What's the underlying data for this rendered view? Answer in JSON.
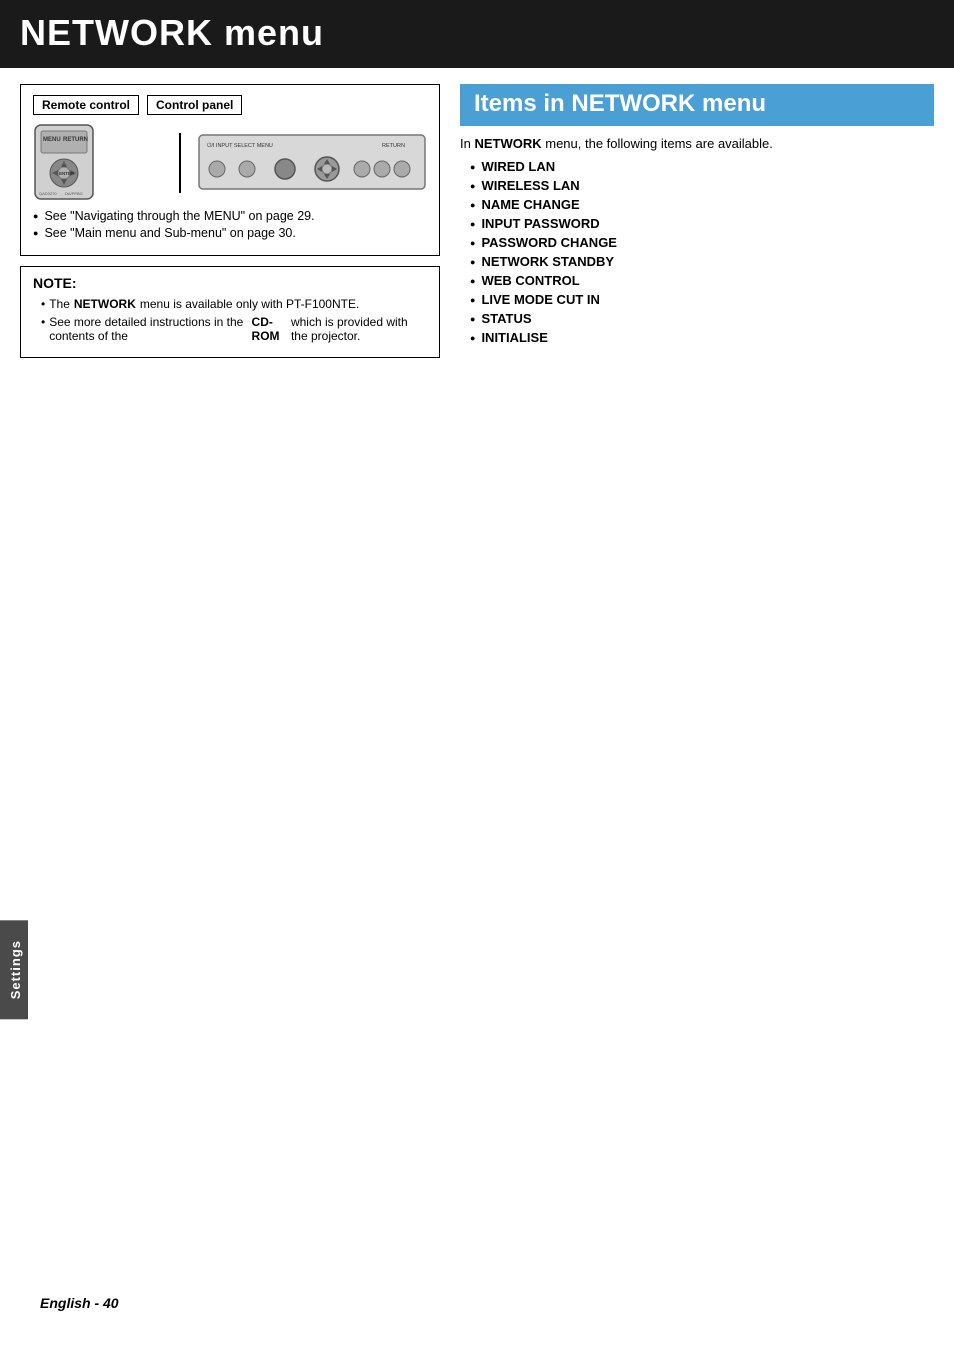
{
  "page": {
    "title": "NETWORK menu",
    "footer": "English - 40"
  },
  "left_panel": {
    "remote_label": "Remote control",
    "control_label": "Control panel",
    "bullets": [
      "See \"Navigating through the MENU\" on page 29.",
      "See \"Main menu and Sub-menu\" on page 30."
    ]
  },
  "note": {
    "title": "NOTE:",
    "items": [
      "The NETWORK menu is available only with PT-F100NTE.",
      "See more detailed instructions in the contents of the CD-ROM which is provided with the projector."
    ],
    "bold_words": [
      "NETWORK",
      "CD-ROM"
    ]
  },
  "right_panel": {
    "title": "Items in NETWORK menu",
    "intro": "In NETWORK menu, the following items are available.",
    "intro_bold": "NETWORK",
    "items": [
      "WIRED LAN",
      "WIRELESS LAN",
      "NAME CHANGE",
      "INPUT PASSWORD",
      "PASSWORD CHANGE",
      "NETWORK STANDBY",
      "WEB CONTROL",
      "LIVE MODE CUT IN",
      "STATUS",
      "INITIALISE"
    ]
  },
  "side_tab": {
    "label": "Settings"
  }
}
